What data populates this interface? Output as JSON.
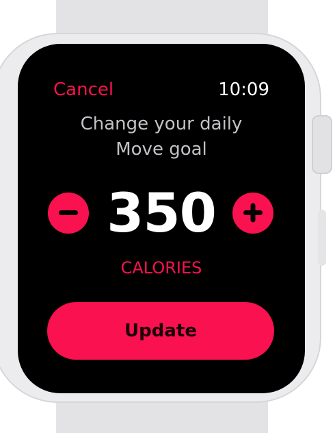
{
  "header": {
    "cancel_label": "Cancel",
    "time": "10:09"
  },
  "prompt": {
    "line1": "Change your daily",
    "line2": "Move goal"
  },
  "goal": {
    "value": "350",
    "unit": "CALORIES"
  },
  "controls": {
    "decrease_icon": "minus-icon",
    "increase_icon": "plus-icon",
    "update_label": "Update"
  },
  "colors": {
    "accent": "#fa114f",
    "screen_background": "#000000",
    "primary_text": "#ffffff",
    "secondary_text": "#c2c2c6"
  }
}
